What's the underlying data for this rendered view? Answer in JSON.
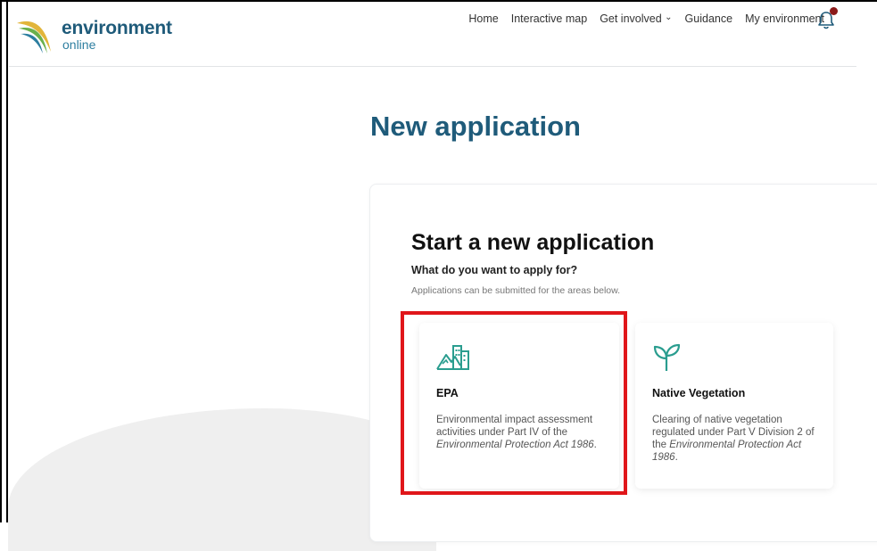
{
  "header": {
    "logo_primary": "environment",
    "logo_secondary": "online",
    "nav": [
      "Home",
      "Interactive map",
      "Get involved",
      "Guidance",
      "My environment"
    ],
    "get_involved_chevron": "⌄"
  },
  "page": {
    "title": "New application"
  },
  "panel": {
    "title": "Start a new application",
    "subtitle": "What do you want to apply for?",
    "note": "Applications can be submitted for the areas below."
  },
  "cards": [
    {
      "title": "EPA",
      "desc_start": "Environmental impact assessment activities under Part IV of the ",
      "desc_italic": "Environmental Protection Act 1986",
      "desc_end": ".",
      "icon": "buildings-mountain-icon"
    },
    {
      "title": "Native Vegetation",
      "desc_start": "Clearing of native vegetation regulated under Part V Division 2 of the ",
      "desc_italic": "Environmental Protection Act 1986",
      "desc_end": ".",
      "icon": "sprout-icon"
    }
  ],
  "colors": {
    "brand": "#1f5b7a",
    "icon_teal": "#2a9d8f",
    "highlight": "#e0161a",
    "notification": "#8b1a1a"
  }
}
